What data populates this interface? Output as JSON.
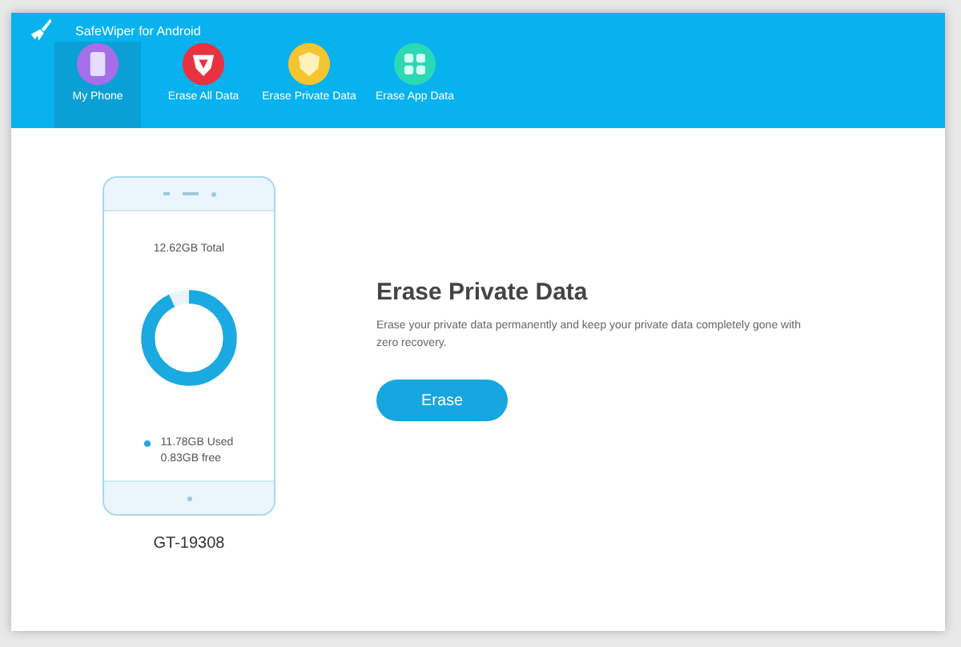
{
  "window": {
    "title": "SafeWiper for Android"
  },
  "tabs": [
    {
      "label": "My Phone",
      "kind": "phone",
      "color": "#a66ee8",
      "selected": true
    },
    {
      "label": "Erase All Data",
      "kind": "badge",
      "color": "#e8323f",
      "selected": false
    },
    {
      "label": "Erase Private Data",
      "kind": "shield",
      "color": "#f5c531",
      "selected": false
    },
    {
      "label": "Erase App Data",
      "kind": "grid",
      "color": "#2dd9b4",
      "selected": false
    }
  ],
  "phone": {
    "total": "12.62GB Total",
    "level": 0.93,
    "used": "11.78GB Used",
    "free": "0.83GB free",
    "model": "GT-19308"
  },
  "panel": {
    "heading": "Erase Private Data",
    "description": "Erase your private data permanently and keep your private data completely gone with zero recovery.",
    "button": "Erase"
  }
}
